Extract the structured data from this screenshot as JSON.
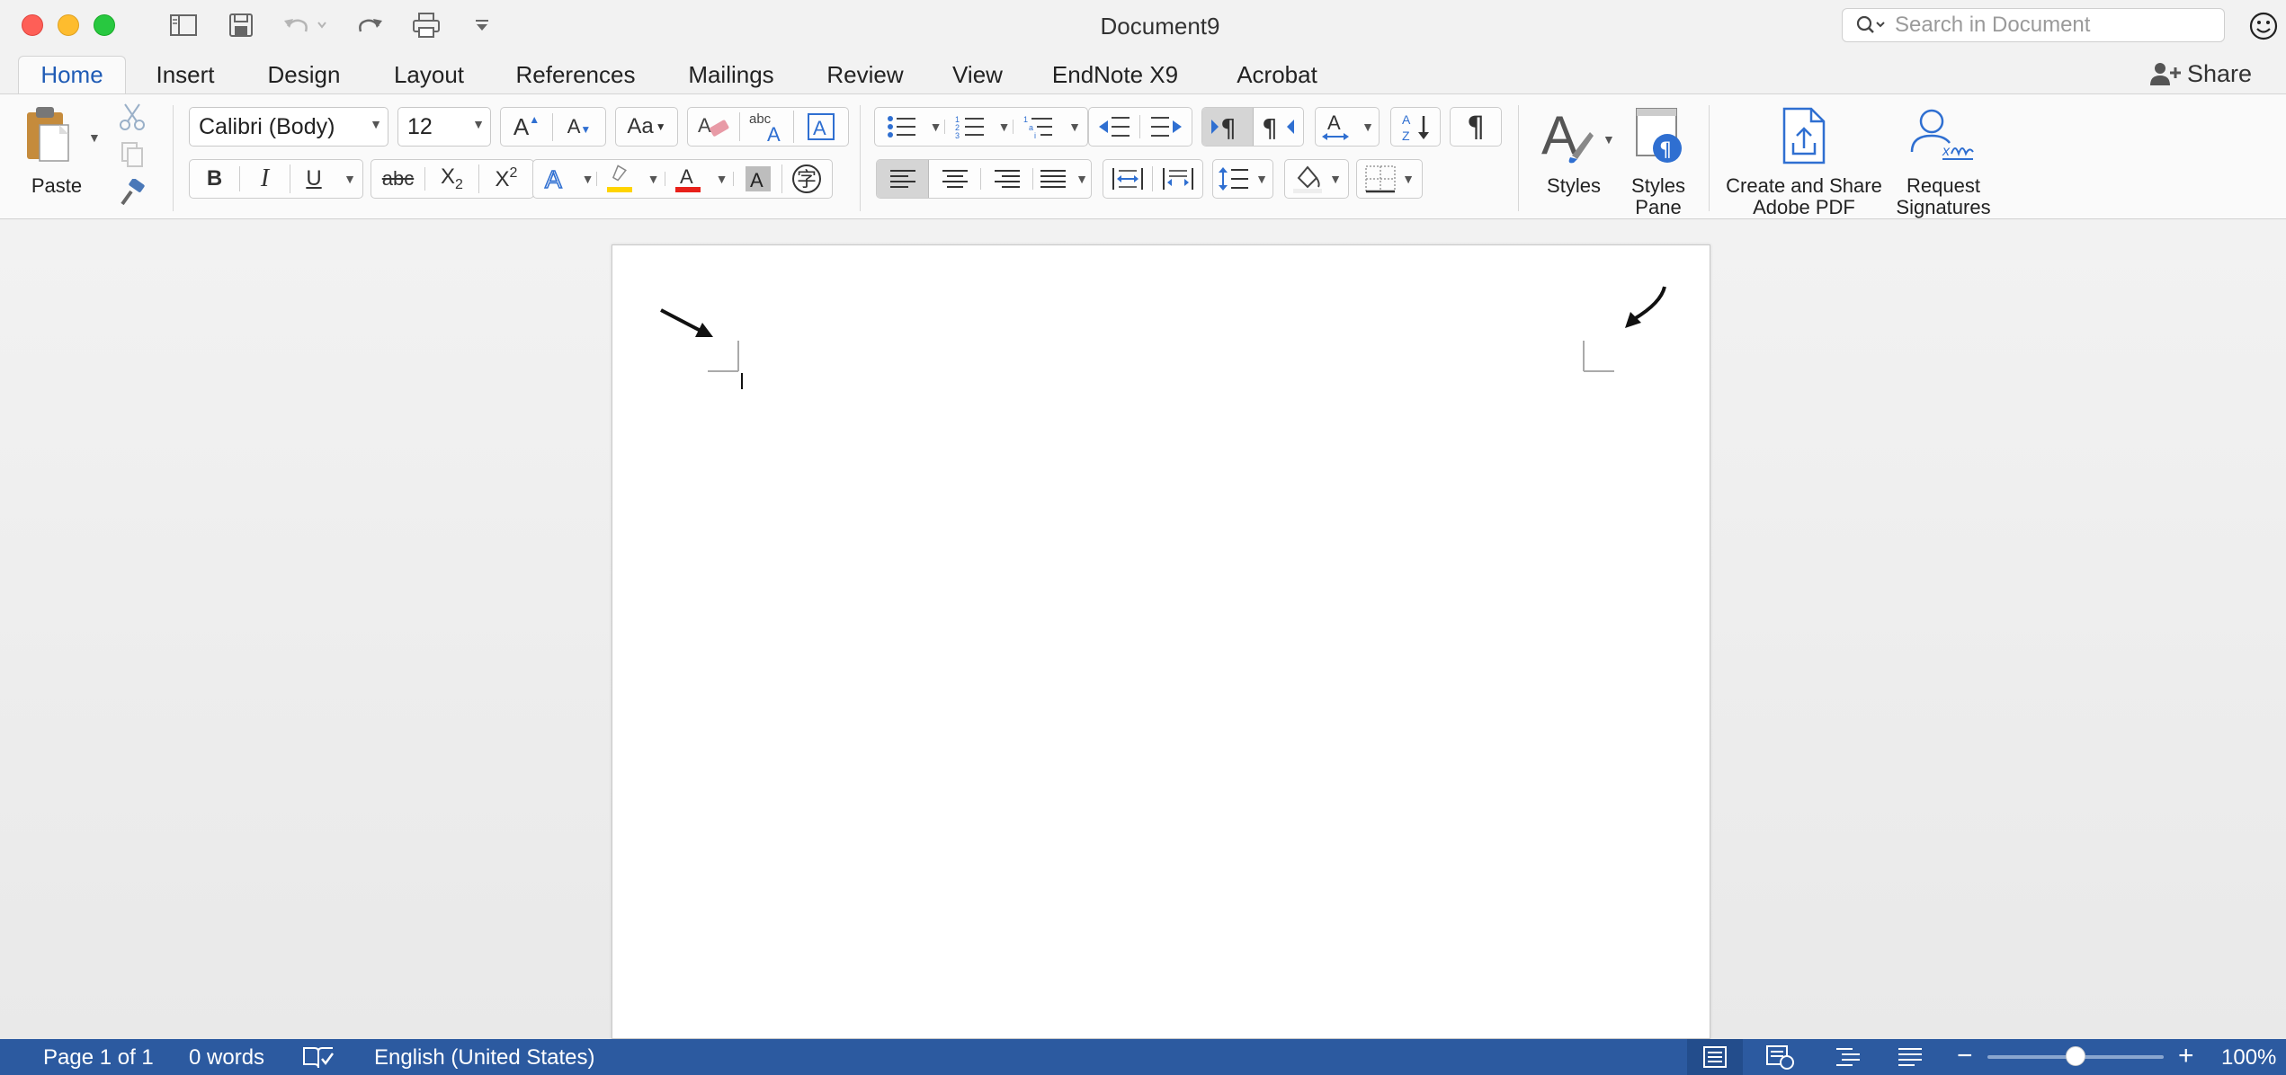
{
  "window": {
    "title": "Document9",
    "search_placeholder": "Search in Document"
  },
  "tabs": [
    "Home",
    "Insert",
    "Design",
    "Layout",
    "References",
    "Mailings",
    "Review",
    "View",
    "EndNote X9",
    "Acrobat"
  ],
  "active_tab": "Home",
  "share_label": "Share",
  "ribbon": {
    "paste_label": "Paste",
    "font_name": "Calibri (Body)",
    "font_size": "12",
    "styles_label": "Styles",
    "styles_pane_label_1": "Styles",
    "styles_pane_label_2": "Pane",
    "create_pdf_label_1": "Create and Share",
    "create_pdf_label_2": "Adobe PDF",
    "request_sig_label_1": "Request",
    "request_sig_label_2": "Signatures",
    "bold": "B",
    "italic": "I",
    "underline": "U",
    "strike": "abc",
    "subscript_base": "X",
    "subscript_mark": "2",
    "superscript_base": "X",
    "superscript_mark": "2",
    "char_phonetic": "字",
    "pilcrow": "¶",
    "spell_abc": "abc",
    "colors": {
      "highlight": "#ffd400",
      "font_color": "#e8201a",
      "accent": "#1f5bb5",
      "statusbar": "#2c5aa0"
    }
  },
  "status": {
    "page": "Page 1 of 1",
    "words": "0 words",
    "language": "English (United States)",
    "zoom": "100%",
    "zoom_minus": "−",
    "zoom_plus": "+",
    "zoom_level_fraction": 0.5
  }
}
